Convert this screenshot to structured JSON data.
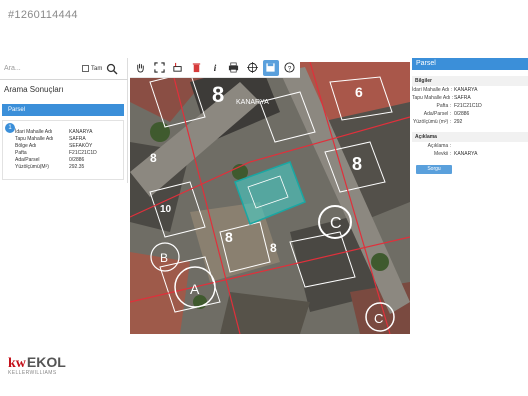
{
  "listing_id": "#1260114444",
  "search": {
    "placeholder": "Ara...",
    "tam_label": "Tam"
  },
  "results": {
    "title": "Arama Sonuçları",
    "section_label": "Parsel",
    "badge": "1",
    "rows": [
      {
        "k": "İdari Mahalle Adı",
        "v": "KANARYA"
      },
      {
        "k": "Tapu Mahalle Adı",
        "v": "SAFRA"
      },
      {
        "k": "Bölge Adı",
        "v": "SEFAKÖY"
      },
      {
        "k": "Pafta",
        "v": "F21C21C1D"
      },
      {
        "k": "Ada/Parsel",
        "v": "0/2886"
      },
      {
        "k": "Yüzölçümü(M²)",
        "v": "292.35"
      }
    ]
  },
  "toolbar": {
    "icons": [
      "hand-icon",
      "fullscreen-icon",
      "measure-icon",
      "trash-icon",
      "info-icon",
      "print-icon",
      "crosshair-icon",
      "save-icon",
      "help-icon"
    ],
    "active_icon": "save-icon"
  },
  "map": {
    "street_label": "KANARYA",
    "parcel_fill": "#3fd6d0",
    "parcel_outline": "#1aa7a3",
    "boundary_color": "#e0303b",
    "line_color": "#ffffff",
    "numbers": [
      "8",
      "10",
      "8",
      "8",
      "6",
      "8",
      "8"
    ],
    "block_labels": [
      "A",
      "C",
      "B",
      "C",
      "A"
    ]
  },
  "info_panel": {
    "title": "Parsel",
    "bilgiler": "Bilgiler",
    "rows": [
      {
        "k": "İdari Mahalle Adı :",
        "v": "KANARYA"
      },
      {
        "k": "Tapu Mahalle Adı :",
        "v": "SAFRA"
      },
      {
        "k": "Pafta :",
        "v": "F21C21C1D"
      },
      {
        "k": "Ada/Parsel :",
        "v": "0/2886"
      },
      {
        "k": "Yüzölçümü (m²) :",
        "v": "292"
      }
    ],
    "aciklama": "Açıklama",
    "aciklama_rows": [
      {
        "k": "Açıklama :",
        "v": ""
      },
      {
        "k": "Mevkii :",
        "v": "KANARYA"
      }
    ],
    "button_label": "Sorgu"
  },
  "logo": {
    "kw": "kw",
    "name": "EKOL",
    "sub": "KELLERWILLIAMS"
  },
  "brand_colors": {
    "accent": "#3b8fd9",
    "logo_red": "#c4101a"
  }
}
